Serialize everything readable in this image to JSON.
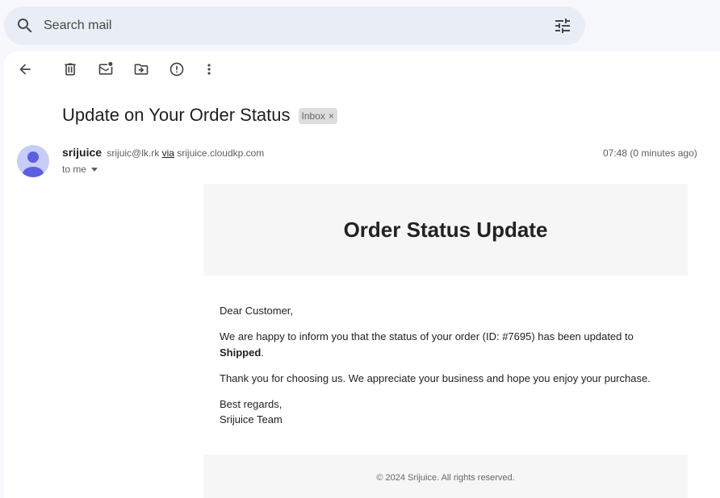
{
  "search": {
    "placeholder": "Search mail"
  },
  "toolbar": {
    "back": "arrow-back-icon",
    "delete": "trash-icon",
    "mark_unread": "mark-unread-icon",
    "move_to": "move-to-folder-icon",
    "report_spam": "report-spam-icon",
    "more": "more-vert-icon"
  },
  "message": {
    "subject": "Update on Your Order Status",
    "label": "Inbox",
    "label_remove": "×",
    "sender_name": "srijuice",
    "sender_email": "srijuic@lk.rk",
    "via_text": "via",
    "via_domain": "srijuice.cloudkp.com",
    "to": "to me",
    "timestamp": "07:48 (0 minutes ago)"
  },
  "email": {
    "header_title": "Order Status Update",
    "greeting": "Dear Customer,",
    "line1_prefix": "We are happy to inform you that the status of your order (ID: #7695) has been updated to",
    "status": "Shipped",
    "line1_suffix": ".",
    "thanks": "Thank you for choosing us. We appreciate your business and hope you enjoy your purchase.",
    "regards": "Best regards,",
    "team": "Srijuice Team",
    "footer": "© 2024 Srijuice. All rights reserved."
  },
  "colors": {
    "background": "#f6f8fc",
    "search_bg": "#e9eef6",
    "avatar_bg": "#c7cdf8",
    "avatar_fg": "#5b5fe0"
  }
}
